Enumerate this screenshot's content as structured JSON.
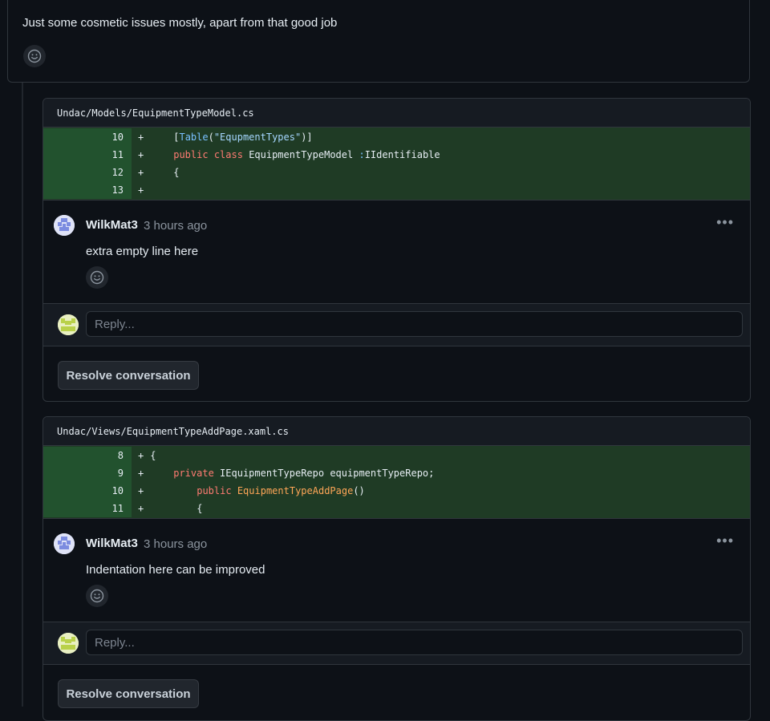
{
  "review": {
    "text": "Just some cosmetic issues mostly, apart from that good job",
    "reaction_icon": "smiley-icon"
  },
  "threads": [
    {
      "file_path": "Undac/Models/EquipmentTypeModel.cs",
      "diff": [
        {
          "line": "10",
          "sign": "+"
        },
        {
          "line": "11",
          "sign": "+"
        },
        {
          "line": "12",
          "sign": "+"
        },
        {
          "line": "13",
          "sign": "+"
        }
      ],
      "code": {
        "l10_open": "[",
        "l10_type": "Table",
        "l10_paren": "(",
        "l10_str": "\"EqupmentTypes\"",
        "l10_close": ")]",
        "l11_kw1": "public",
        "l11_kw2": "class",
        "l11_name": "EquipmentTypeModel",
        "l11_sep": ":",
        "l11_base": "IIdentifiable",
        "l12_text": "{",
        "l13_text": ""
      },
      "comment": {
        "author": "WilkMat3",
        "time": "3 hours ago",
        "body": "extra empty line here",
        "more_icon": "•••"
      },
      "reply_placeholder": "Reply...",
      "resolve_label": "Resolve conversation"
    },
    {
      "file_path": "Undac/Views/EquipmentTypeAddPage.xaml.cs",
      "diff": [
        {
          "line": "8",
          "sign": "+"
        },
        {
          "line": "9",
          "sign": "+"
        },
        {
          "line": "10",
          "sign": "+"
        },
        {
          "line": "11",
          "sign": "+"
        }
      ],
      "code": {
        "l8_text": "{",
        "l9_kw": "private",
        "l9_type": "IEquipmentTypeRepo",
        "l9_name": "equipmentTypeRepo;",
        "l10_kw": "public",
        "l10_fn": "EquipmentTypeAddPage",
        "l10_paren": "()",
        "l11_text": "{"
      },
      "comment": {
        "author": "WilkMat3",
        "time": "3 hours ago",
        "body": "Indentation here can be improved",
        "more_icon": "•••"
      },
      "reply_placeholder": "Reply...",
      "resolve_label": "Resolve conversation"
    }
  ],
  "colors": {
    "background": "#0d1117",
    "diff_added": "#1f3b25",
    "author_avatar": "#7c8ce0",
    "user_avatar": "#b9d14a"
  }
}
